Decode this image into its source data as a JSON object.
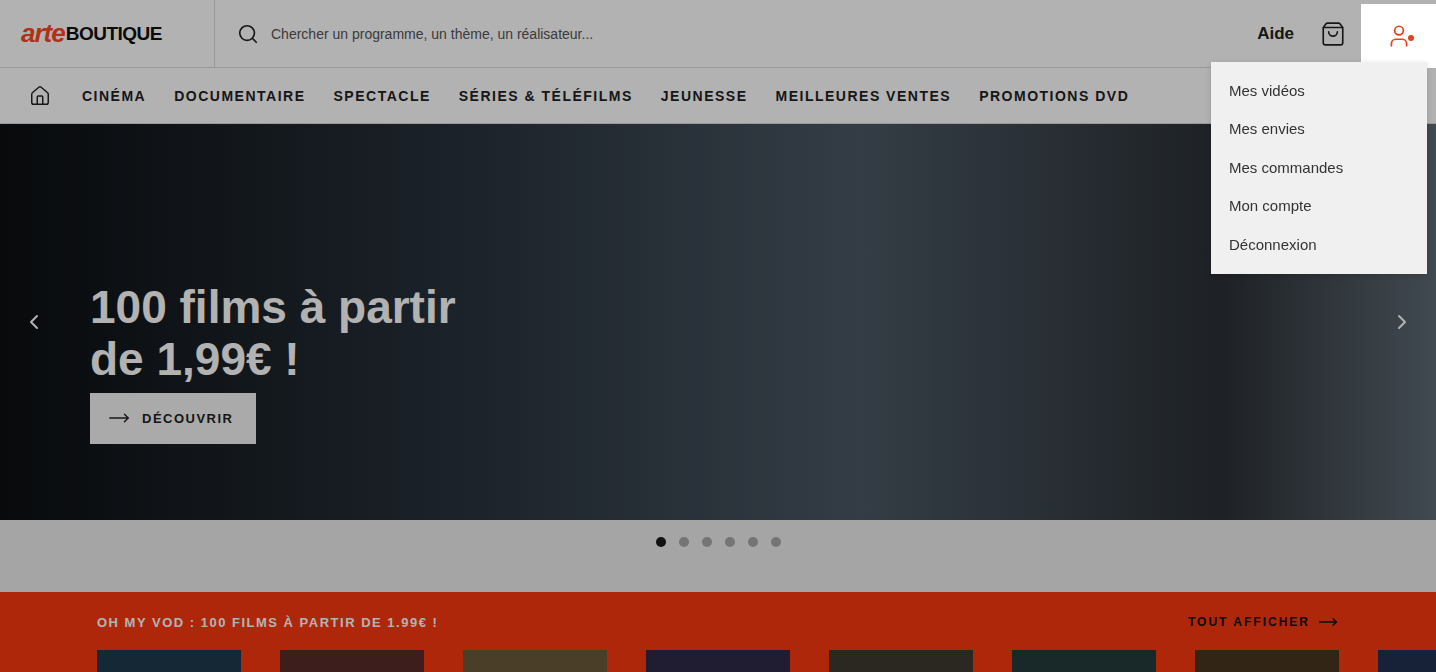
{
  "header": {
    "logo": {
      "arte": "arte",
      "boutique": "BOUTIQUE"
    },
    "search": {
      "placeholder": "Chercher un programme, un thème, un réalisateur..."
    },
    "help": "Aide",
    "account": {
      "open": true,
      "notification": true
    }
  },
  "nav": {
    "items": [
      {
        "label": "CINÉMA"
      },
      {
        "label": "DOCUMENTAIRE"
      },
      {
        "label": "SPECTACLE"
      },
      {
        "label": "SÉRIES & TÉLÉFILMS"
      },
      {
        "label": "JEUNESSE"
      },
      {
        "label": "MEILLEURES VENTES"
      },
      {
        "label": "PROMOTIONS DVD"
      }
    ]
  },
  "account_menu": {
    "items": [
      "Mes vidéos",
      "Mes envies",
      "Mes commandes",
      "Mon compte",
      "Déconnexion"
    ]
  },
  "hero": {
    "title": "100 films à partir de 1,99€ !",
    "button": "DÉCOUVRIR",
    "dots": [
      {
        "selected": true
      },
      {
        "selected": false
      },
      {
        "selected": false
      },
      {
        "selected": false
      },
      {
        "selected": false
      },
      {
        "selected": false
      }
    ]
  },
  "strip": {
    "title": "OH MY VOD : 100 FILMS À PARTIR DE 1.99€ !",
    "link": "TOUT AFFICHER"
  }
}
